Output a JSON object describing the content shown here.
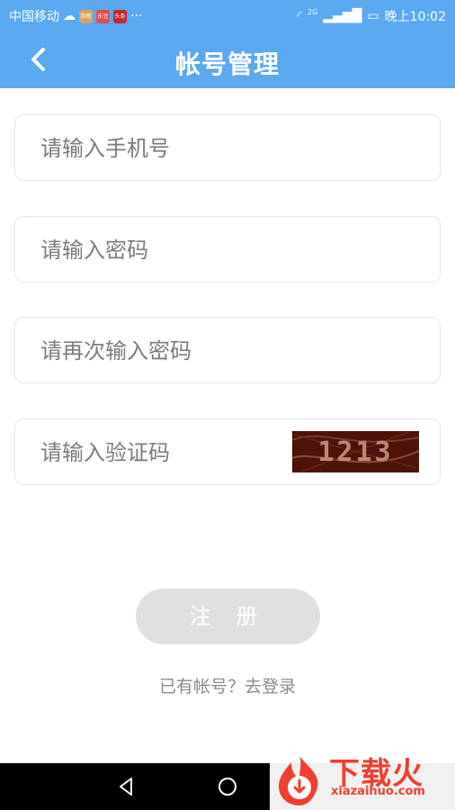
{
  "status_bar": {
    "carrier": "中国移动",
    "notification_badges": [
      "购物",
      "乐豆",
      "头条"
    ],
    "notification_overflow": "···",
    "network_label": "2G",
    "time": "晚上10:02"
  },
  "header": {
    "title": "帐号管理"
  },
  "form": {
    "phone_placeholder": "请输入手机号",
    "password_placeholder": "请输入密码",
    "confirm_password_placeholder": "请再次输入密码",
    "captcha_placeholder": "请输入验证码",
    "captcha_value": "1213"
  },
  "actions": {
    "register_label": "注 册",
    "login_link": "已有帐号？去登录"
  },
  "watermark": {
    "title": "下载火",
    "domain": "xiazaihuo.com"
  },
  "colors": {
    "primary": "#5aa8f0",
    "button_disabled": "#e0e0e0",
    "watermark": "#ef3f2f"
  }
}
